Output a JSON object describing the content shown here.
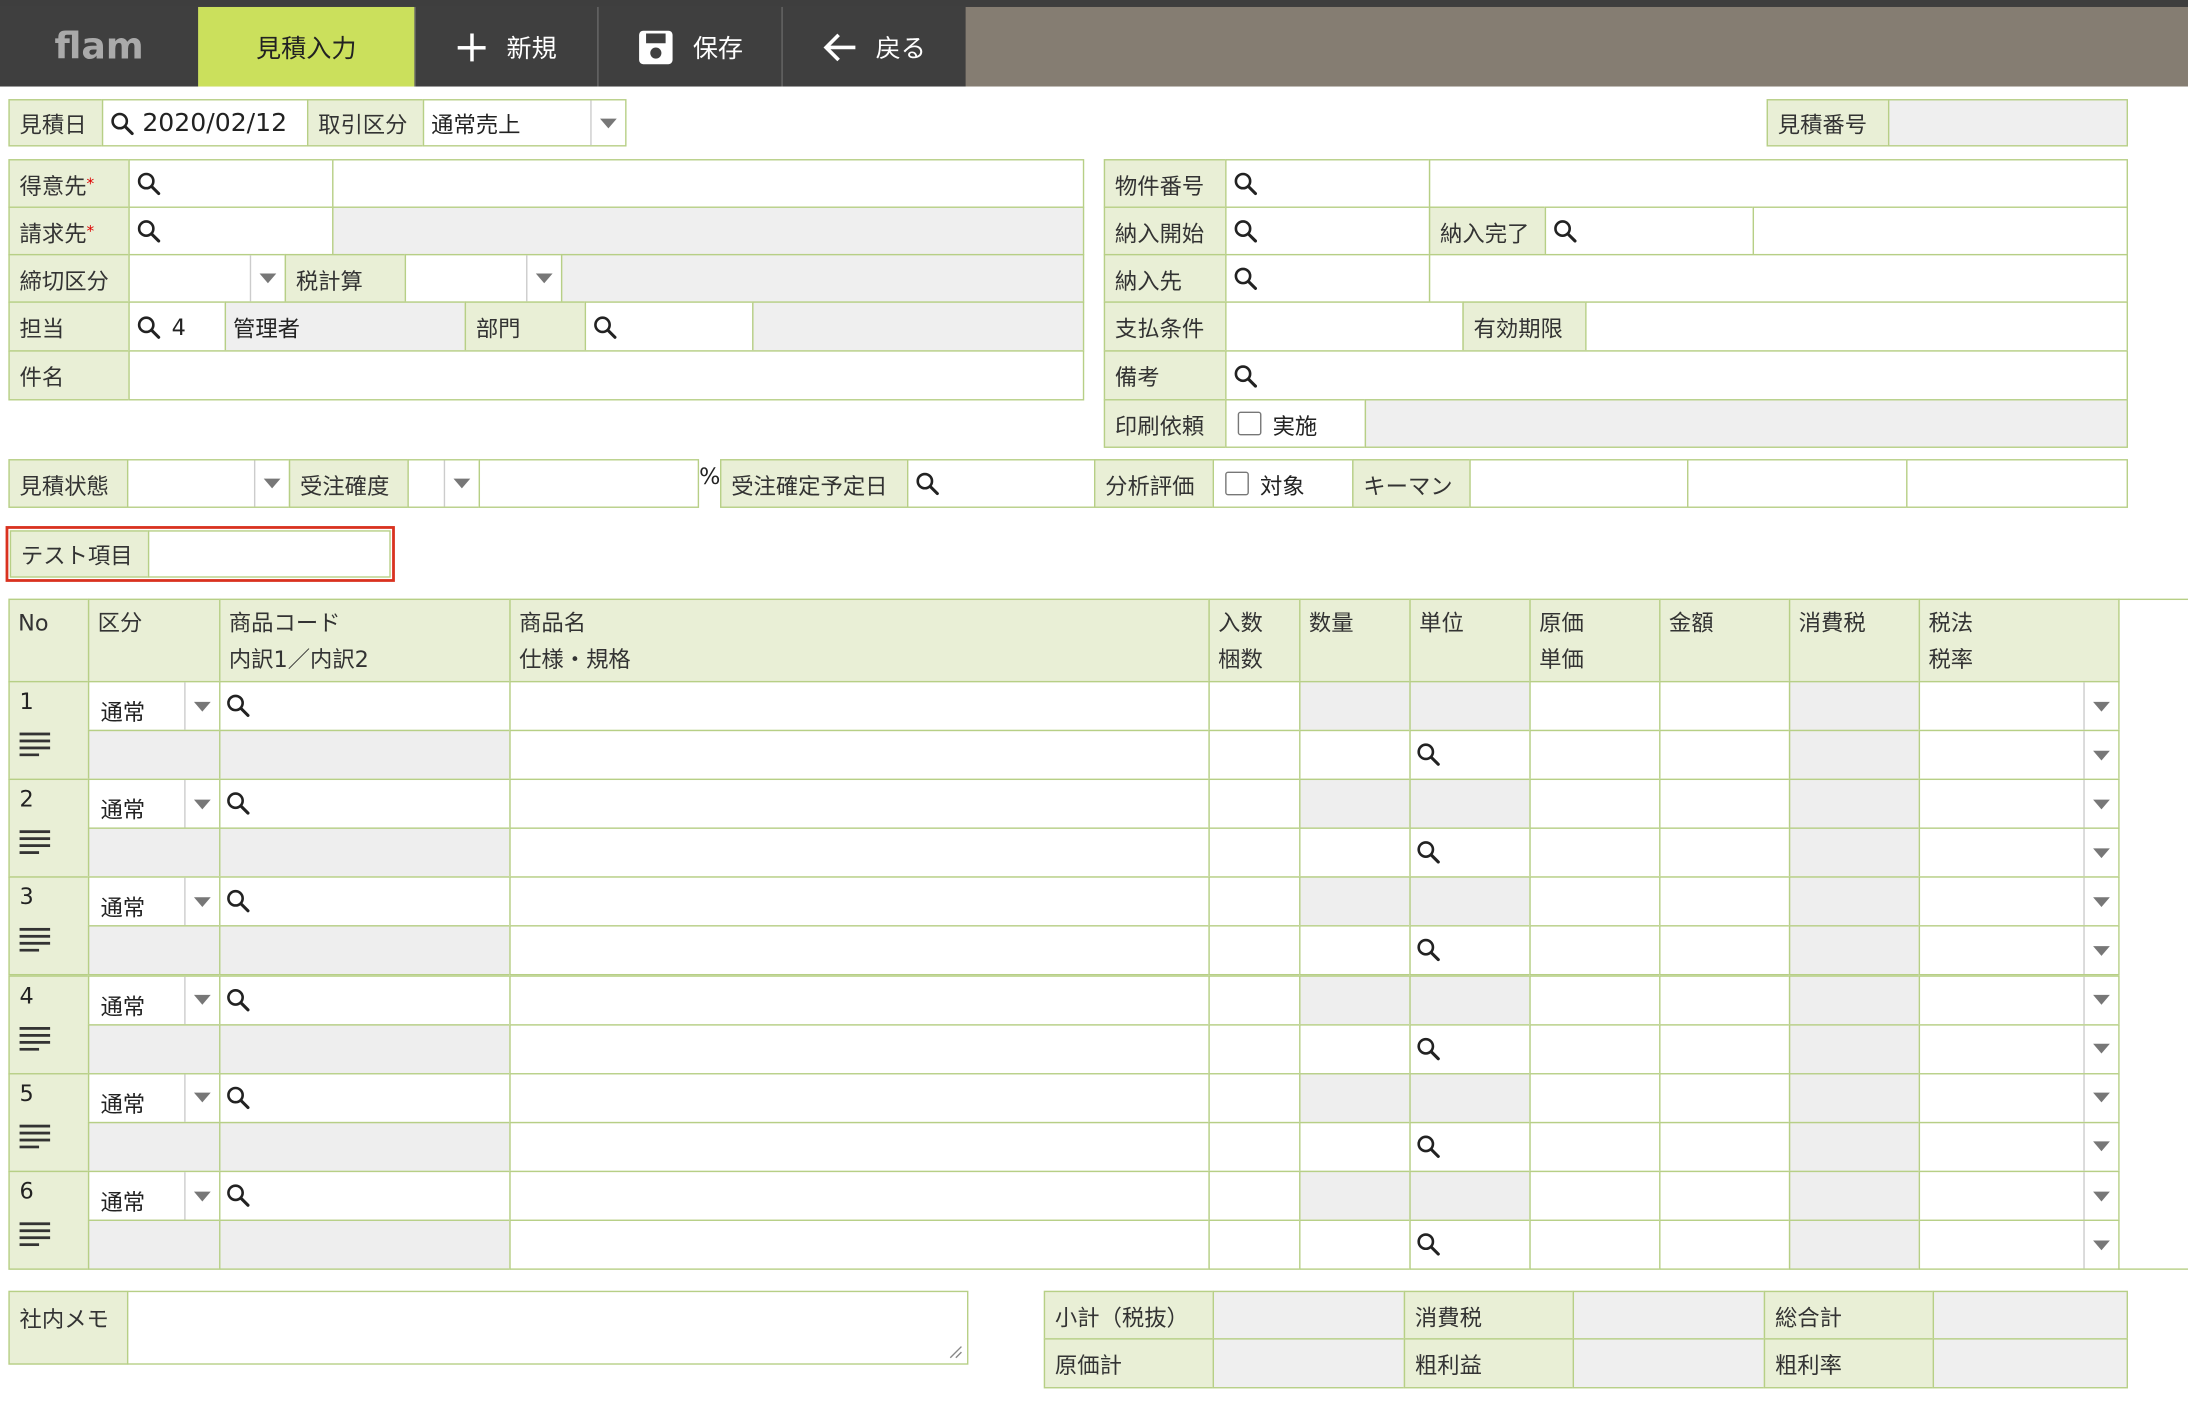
{
  "app": {
    "logo": "flam"
  },
  "nav": {
    "tabs": [
      {
        "label": "見積入力"
      },
      {
        "label": "新規"
      },
      {
        "label": "保存"
      },
      {
        "label": "戻る"
      }
    ]
  },
  "header": {
    "estimate_date_label": "見積日",
    "estimate_date": "2020/02/12",
    "trade_type_label": "取引区分",
    "trade_type": "通常売上",
    "estimate_no_label": "見積番号"
  },
  "left": {
    "customer_label": "得意先",
    "billing_label": "請求先",
    "required_mark": "*",
    "closing_label": "締切区分",
    "tax_calc_label": "税計算",
    "staff_label": "担当",
    "staff_code": "4",
    "staff_name": "管理者",
    "dept_label": "部門",
    "subject_label": "件名"
  },
  "right": {
    "property_no_label": "物件番号",
    "delivery_start_label": "納入開始",
    "delivery_end_label": "納入完了",
    "delivery_to_label": "納入先",
    "payment_label": "支払条件",
    "validity_label": "有効期限",
    "remarks_label": "備考",
    "print_label": "印刷依頼",
    "print_check": "実施"
  },
  "status": {
    "state_label": "見積状態",
    "prob_label": "受注確度",
    "percent": "%",
    "order_date_label": "受注確定予定日",
    "analysis_label": "分析評価",
    "analysis_check": "対象",
    "keyman_label": "キーマン"
  },
  "test_label": "テスト項目",
  "table": {
    "headers": {
      "no": "No",
      "kubun": "区分",
      "code1": "商品コード",
      "code2": "内訳1／内訳2",
      "name1": "商品名",
      "name2": "仕様・規格",
      "qty_in1": "入数",
      "qty_in2": "梱数",
      "qty": "数量",
      "unit": "単位",
      "cost1": "原価",
      "cost2": "単価",
      "amount": "金額",
      "tax": "消費税",
      "taxlaw1": "税法",
      "taxlaw2": "税率"
    },
    "rows": [
      {
        "no": "1",
        "kubun": "通常"
      },
      {
        "no": "2",
        "kubun": "通常"
      },
      {
        "no": "3",
        "kubun": "通常"
      },
      {
        "no": "4",
        "kubun": "通常"
      },
      {
        "no": "5",
        "kubun": "通常"
      },
      {
        "no": "6",
        "kubun": "通常"
      }
    ]
  },
  "footer": {
    "memo_label": "社内メモ",
    "subtotal_label": "小計（税抜）",
    "tax_label": "消費税",
    "total_label": "総合計",
    "cost_total_label": "原価計",
    "gross_profit_label": "粗利益",
    "gross_rate_label": "粗利率"
  },
  "colors": {
    "accent": "#cbe05c",
    "label_bg": "#e9efd6",
    "border": "#b7cf86",
    "nav_bg": "#3f3f3f",
    "bar_bg": "#857d72",
    "highlight": "#d9321f"
  }
}
